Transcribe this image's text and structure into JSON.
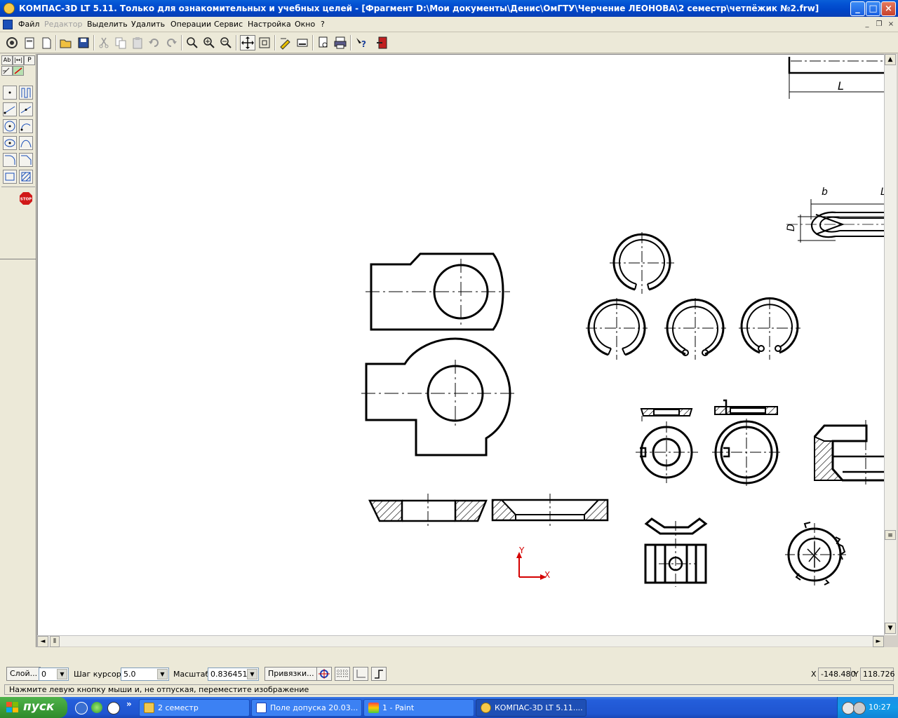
{
  "window": {
    "title": "КОМПАС-3D LT 5.11. Только для ознакомительных и учебных целей - [Фрагмент D:\\Мои документы\\Денис\\ОмГТУ\\Черчение ЛЕОНОВА\\2 семестр\\четпёжик №2.frw]",
    "min_label": "_",
    "max_label": "□",
    "close_label": "×"
  },
  "menu": {
    "items": [
      "Файл",
      "Редактор",
      "Выделить",
      "Удалить",
      "Операции",
      "Сервис",
      "Настройка",
      "Окно",
      "?"
    ],
    "disabled": [
      "Редактор"
    ]
  },
  "left_panel": {
    "tabs": [
      "Ab",
      "|↔|",
      "P"
    ]
  },
  "drawing": {
    "dim_labels": {
      "L_top": "L",
      "b": "b",
      "L2": "L",
      "D": "D"
    },
    "axis_labels": {
      "x": "X",
      "y": "Y"
    },
    "colors": {
      "axis": "#d40000",
      "line": "#000000",
      "background": "#ffffff"
    }
  },
  "statusbar": {
    "layer_button": "Слой...",
    "layer_value": "0",
    "step_label": "Шаг курсора",
    "step_value": "5.0",
    "scale_label": "Масштаб",
    "scale_value": "0.836451",
    "snap_button": "Привязки...",
    "x_label": "X",
    "x_value": "-148.480",
    "y_label": "Y",
    "y_value": "118.726",
    "hint": "Нажмите левую кнопку мыши и, не отпуская, переместите изображение"
  },
  "taskbar": {
    "start_label": "пуск",
    "more_label": "»",
    "tasks": [
      {
        "label": "2 семестр",
        "icon": "folder-icon"
      },
      {
        "label": "Поле допуска 20.03...",
        "icon": "word-icon"
      },
      {
        "label": "1 - Paint",
        "icon": "paint-icon"
      },
      {
        "label": "КОМПАС-3D LT 5.11....",
        "icon": "kompas-icon"
      }
    ],
    "clock": "10:27"
  }
}
